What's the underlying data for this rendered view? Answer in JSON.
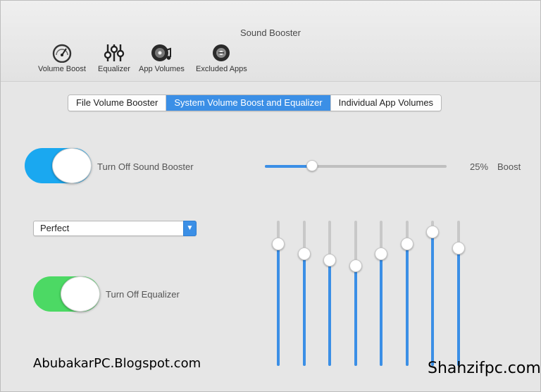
{
  "window": {
    "title": "Sound Booster"
  },
  "toolbar": {
    "items": [
      {
        "label": "Volume Boost",
        "icon": "speedometer-icon"
      },
      {
        "label": "Equalizer",
        "icon": "equalizer-icon"
      },
      {
        "label": "App Volumes",
        "icon": "disc-music-icon"
      },
      {
        "label": "Excluded Apps",
        "icon": "excluded-disc-icon"
      }
    ]
  },
  "tabs": [
    {
      "label": "File Volume Booster",
      "active": false
    },
    {
      "label": "System Volume Boost and Equalizer",
      "active": true
    },
    {
      "label": "Individual App Volumes",
      "active": false
    }
  ],
  "booster": {
    "toggle_label": "Turn Off Sound Booster",
    "toggle_color": "#1aa8f0",
    "boost_fraction": 0.26,
    "boost_value": "25%",
    "boost_label": "Boost"
  },
  "preset": {
    "selected": "Perfect"
  },
  "equalizer": {
    "toggle_label": "Turn Off Equalizer",
    "toggle_color": "#4cd964",
    "band_levels": [
      0.84,
      0.77,
      0.73,
      0.69,
      0.77,
      0.84,
      0.92,
      0.81
    ]
  },
  "accent_color": "#3b8fe6",
  "watermarks": {
    "left": "AbubakarPC.Blogspot.com",
    "right": "Shahzifpc.com"
  }
}
